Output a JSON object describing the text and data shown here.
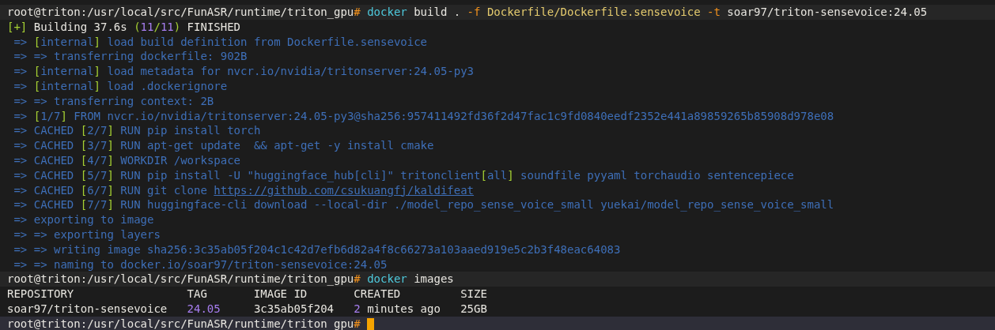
{
  "terminal": {
    "lines": [
      {
        "kind": "prompt",
        "segments": [
          {
            "kind": "prompt",
            "text": "root@triton:/usr/local/src/FunASR/runtime/triton_gpu"
          },
          {
            "kind": "hash",
            "text": "#"
          },
          {
            "kind": "cmd",
            "text": " docker"
          },
          {
            "kind": "plain",
            "text": " build . "
          },
          {
            "kind": "flag",
            "text": "-f"
          },
          {
            "kind": "arg",
            "text": " Dockerfile/Dockerfile.sensevoice"
          },
          {
            "kind": "flag",
            "text": " -t"
          },
          {
            "kind": "plain",
            "text": " soar97/triton-sensevoice:24.05"
          }
        ]
      },
      {
        "kind": "output",
        "segments": [
          {
            "kind": "bracket",
            "text": "[+]"
          },
          {
            "kind": "plain",
            "text": " Building 37.6s "
          },
          {
            "kind": "bracket",
            "text": "("
          },
          {
            "kind": "num",
            "text": "11"
          },
          {
            "kind": "bracket",
            "text": "/"
          },
          {
            "kind": "num",
            "text": "11"
          },
          {
            "kind": "bracket",
            "text": ")"
          },
          {
            "kind": "plain",
            "text": " FINISHED"
          }
        ]
      },
      {
        "kind": "output",
        "segments": [
          {
            "kind": "log",
            "text": " => "
          },
          {
            "kind": "bracket",
            "text": "["
          },
          {
            "kind": "log",
            "text": "internal"
          },
          {
            "kind": "bracket",
            "text": "]"
          },
          {
            "kind": "log",
            "text": " load build definition from Dockerfile.sensevoice"
          }
        ]
      },
      {
        "kind": "output",
        "segments": [
          {
            "kind": "log",
            "text": " => => transferring dockerfile: 902B"
          }
        ]
      },
      {
        "kind": "output",
        "segments": [
          {
            "kind": "log",
            "text": " => "
          },
          {
            "kind": "bracket",
            "text": "["
          },
          {
            "kind": "log",
            "text": "internal"
          },
          {
            "kind": "bracket",
            "text": "]"
          },
          {
            "kind": "log",
            "text": " load metadata for nvcr.io/nvidia/tritonserver:24.05-py3"
          }
        ]
      },
      {
        "kind": "output",
        "segments": [
          {
            "kind": "log",
            "text": " => "
          },
          {
            "kind": "bracket",
            "text": "["
          },
          {
            "kind": "log",
            "text": "internal"
          },
          {
            "kind": "bracket",
            "text": "]"
          },
          {
            "kind": "log",
            "text": " load .dockerignore"
          }
        ]
      },
      {
        "kind": "output",
        "segments": [
          {
            "kind": "log",
            "text": " => => transferring context: 2B"
          }
        ]
      },
      {
        "kind": "output",
        "segments": [
          {
            "kind": "log",
            "text": " => "
          },
          {
            "kind": "bracket",
            "text": "["
          },
          {
            "kind": "log",
            "text": "1/7"
          },
          {
            "kind": "bracket",
            "text": "]"
          },
          {
            "kind": "log",
            "text": " FROM nvcr.io/nvidia/tritonserver:24.05-py3@sha256:957411492fd36f2d47fac1c9fd0840eedf2352e441a89859265b85908d978e08"
          }
        ]
      },
      {
        "kind": "output",
        "segments": [
          {
            "kind": "log",
            "text": " => CACHED "
          },
          {
            "kind": "bracket",
            "text": "["
          },
          {
            "kind": "log",
            "text": "2/7"
          },
          {
            "kind": "bracket",
            "text": "]"
          },
          {
            "kind": "log",
            "text": " RUN pip install torch"
          }
        ]
      },
      {
        "kind": "output",
        "segments": [
          {
            "kind": "log",
            "text": " => CACHED "
          },
          {
            "kind": "bracket",
            "text": "["
          },
          {
            "kind": "log",
            "text": "3/7"
          },
          {
            "kind": "bracket",
            "text": "]"
          },
          {
            "kind": "log",
            "text": " RUN apt-get update  && apt-get -y install cmake"
          }
        ]
      },
      {
        "kind": "output",
        "segments": [
          {
            "kind": "log",
            "text": " => CACHED "
          },
          {
            "kind": "bracket",
            "text": "["
          },
          {
            "kind": "log",
            "text": "4/7"
          },
          {
            "kind": "bracket",
            "text": "]"
          },
          {
            "kind": "log",
            "text": " WORKDIR /workspace"
          }
        ]
      },
      {
        "kind": "output",
        "segments": [
          {
            "kind": "log",
            "text": " => CACHED "
          },
          {
            "kind": "bracket",
            "text": "["
          },
          {
            "kind": "log",
            "text": "5/7"
          },
          {
            "kind": "bracket",
            "text": "]"
          },
          {
            "kind": "log",
            "text": " RUN pip install -U \"huggingface_hub[cli]\" tritonclient"
          },
          {
            "kind": "bracket",
            "text": "["
          },
          {
            "kind": "log",
            "text": "all"
          },
          {
            "kind": "bracket",
            "text": "]"
          },
          {
            "kind": "log",
            "text": " soundfile pyyaml torchaudio sentencepiece"
          }
        ]
      },
      {
        "kind": "output",
        "segments": [
          {
            "kind": "log",
            "text": " => CACHED "
          },
          {
            "kind": "bracket",
            "text": "["
          },
          {
            "kind": "log",
            "text": "6/7"
          },
          {
            "kind": "bracket",
            "text": "]"
          },
          {
            "kind": "log",
            "text": " RUN git clone "
          },
          {
            "kind": "link",
            "text": "https://github.com/csukuangfj/kaldifeat"
          }
        ]
      },
      {
        "kind": "output",
        "segments": [
          {
            "kind": "log",
            "text": " => CACHED "
          },
          {
            "kind": "bracket",
            "text": "["
          },
          {
            "kind": "log",
            "text": "7/7"
          },
          {
            "kind": "bracket",
            "text": "]"
          },
          {
            "kind": "log",
            "text": " RUN huggingface-cli download --local-dir ./model_repo_sense_voice_small yuekai/model_repo_sense_voice_small"
          }
        ]
      },
      {
        "kind": "output",
        "segments": [
          {
            "kind": "log",
            "text": " => exporting to image"
          }
        ]
      },
      {
        "kind": "output",
        "segments": [
          {
            "kind": "log",
            "text": " => => exporting layers"
          }
        ]
      },
      {
        "kind": "output",
        "segments": [
          {
            "kind": "log",
            "text": " => => writing image sha256:3c35ab05f204c1c42d7efb6d82a4f8c66273a103aaed919e5c2b3f48eac64083"
          }
        ]
      },
      {
        "kind": "output",
        "segments": [
          {
            "kind": "log",
            "text": " => => naming to docker.io/soar97/triton-sensevoice:24.05"
          }
        ]
      },
      {
        "kind": "prompt",
        "segments": [
          {
            "kind": "prompt",
            "text": "root@triton:/usr/local/src/FunASR/runtime/triton_gpu"
          },
          {
            "kind": "hash",
            "text": "#"
          },
          {
            "kind": "cmd",
            "text": " docker"
          },
          {
            "kind": "plain",
            "text": " images"
          }
        ]
      },
      {
        "kind": "output",
        "segments": [
          {
            "kind": "plain",
            "text": "REPOSITORY                 TAG       IMAGE ID       CREATED         SIZE"
          }
        ]
      },
      {
        "kind": "output",
        "segments": [
          {
            "kind": "plain",
            "text": "soar97/triton-sensevoice   "
          },
          {
            "kind": "num",
            "text": "24.05"
          },
          {
            "kind": "plain",
            "text": "     3c35ab05f204   "
          },
          {
            "kind": "num",
            "text": "2"
          },
          {
            "kind": "plain",
            "text": " minutes ago   25GB"
          }
        ]
      },
      {
        "kind": "current",
        "cursor": true,
        "segments": [
          {
            "kind": "prompt",
            "text": "root@triton:/usr/local/src/FunASR/runtime/triton_gpu"
          },
          {
            "kind": "hash",
            "text": "#"
          }
        ]
      }
    ]
  }
}
